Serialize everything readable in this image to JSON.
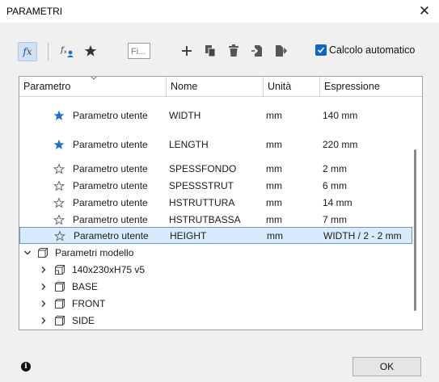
{
  "window": {
    "title": "PARAMETRI",
    "close_symbol": "✕"
  },
  "toolbar": {
    "fx_label": "fx",
    "filter_placeholder": "Fi...",
    "auto_calc_label": "Calcolo automatico",
    "auto_calc_checked": true
  },
  "table": {
    "headers": {
      "parametro": "Parametro",
      "nome": "Nome",
      "unita": "Unità",
      "espressione": "Espressione"
    },
    "rows": [
      {
        "tipo": "Parametro utente",
        "nome": "WIDTH",
        "unita": "mm",
        "espressione": "140 mm",
        "favorite": true
      },
      {
        "tipo": "Parametro utente",
        "nome": "LENGTH",
        "unita": "mm",
        "espressione": "220 mm",
        "favorite": true
      },
      {
        "tipo": "Parametro utente",
        "nome": "SPESSFONDO",
        "unita": "mm",
        "espressione": "2 mm",
        "favorite": false
      },
      {
        "tipo": "Parametro utente",
        "nome": "SPESSSTRUT",
        "unita": "mm",
        "espressione": "6 mm",
        "favorite": false
      },
      {
        "tipo": "Parametro utente",
        "nome": "HSTRUTTURA",
        "unita": "mm",
        "espressione": "14 mm",
        "favorite": false
      },
      {
        "tipo": "Parametro utente",
        "nome": "HSTRUTBASSA",
        "unita": "mm",
        "espressione": "7 mm",
        "favorite": false
      },
      {
        "tipo": "Parametro utente",
        "nome": "HEIGHT",
        "unita": "mm",
        "espressione": "WIDTH / 2 - 2 mm",
        "favorite": false,
        "selected": true
      }
    ],
    "model_group": {
      "label": "Parametri modello",
      "children": [
        {
          "label": "140x230xH75 v5",
          "icon": "component-icon"
        },
        {
          "label": "BASE",
          "icon": "body-icon"
        },
        {
          "label": "FRONT",
          "icon": "body-icon"
        },
        {
          "label": "SIDE",
          "icon": "body-icon"
        }
      ]
    }
  },
  "footer": {
    "ok_label": "OK",
    "info_symbol": "i"
  },
  "colors": {
    "accent": "#1565c0",
    "star": "#1a73c8",
    "selection": "#d9ebfa"
  }
}
